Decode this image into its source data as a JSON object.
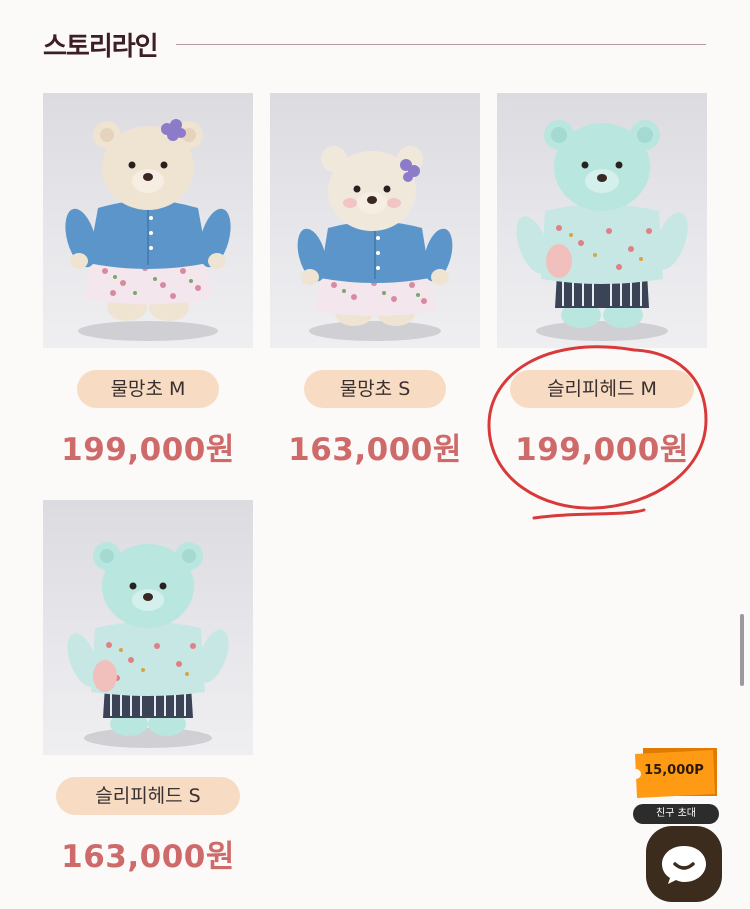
{
  "section": {
    "title": "스토리라인"
  },
  "products": [
    {
      "name": "물망초 M",
      "price": "199,000원"
    },
    {
      "name": "물망초 S",
      "price": "163,000원"
    },
    {
      "name": "슬리피헤드 M",
      "price": "199,000원"
    },
    {
      "name": "슬리피헤드 S",
      "price": "163,000원"
    }
  ],
  "reward": {
    "amount": "15,000P",
    "label": "친구 초대"
  },
  "colors": {
    "accent": "#cf6a6a",
    "pill": "#f7dcc3",
    "annotation": "#d83a3a",
    "title": "#3d1e24"
  }
}
